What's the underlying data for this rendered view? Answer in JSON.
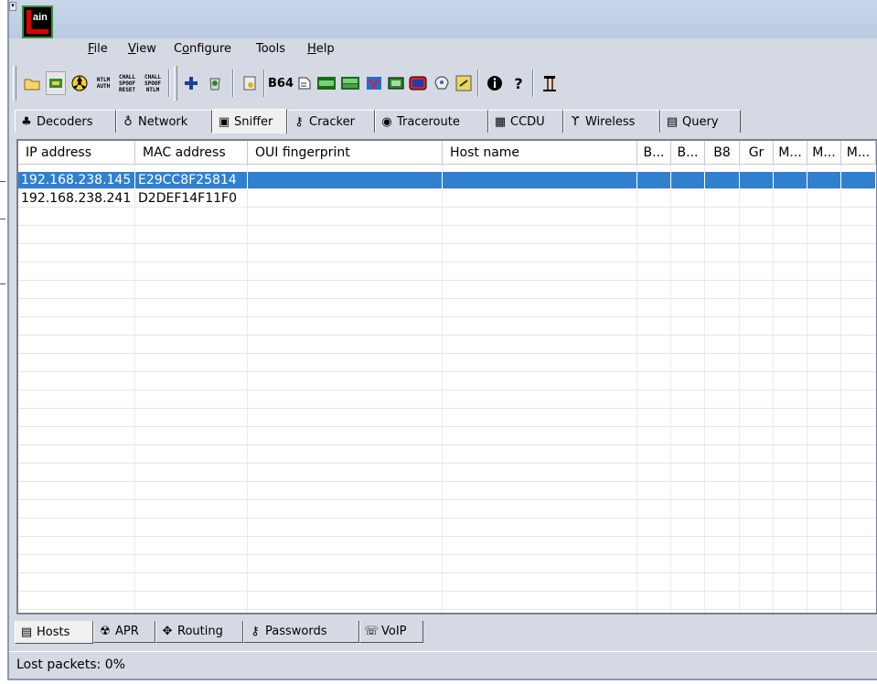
{
  "app": {
    "logo_text": "ain"
  },
  "menu": [
    {
      "label": "File",
      "ul": "F",
      "rest": "ile"
    },
    {
      "label": "View",
      "ul": "V",
      "rest": "iew"
    },
    {
      "label": "Configure",
      "ul": "o",
      "pre": "C",
      "rest": "nfigure"
    },
    {
      "label": "Tools",
      "ul": "",
      "rest": "Tools"
    },
    {
      "label": "Help",
      "ul": "H",
      "rest": "elp"
    }
  ],
  "toolbar": {
    "ntlm_auth": "NTLM\nAUTH",
    "chall_spoof_reset": "CHALL\nSPOOF\nRESET",
    "chall_spoof_ntlm": "CHALL\nSPOOF\nNTLM",
    "b64": "B64"
  },
  "top_tabs": [
    {
      "label": "Decoders",
      "icon": "decoders-icon"
    },
    {
      "label": "Network",
      "icon": "network-icon"
    },
    {
      "label": "Sniffer",
      "icon": "sniffer-icon"
    },
    {
      "label": "Cracker",
      "icon": "cracker-icon"
    },
    {
      "label": "Traceroute",
      "icon": "traceroute-icon"
    },
    {
      "label": "CCDU",
      "icon": "ccdu-icon"
    },
    {
      "label": "Wireless",
      "icon": "wireless-icon"
    },
    {
      "label": "Query",
      "icon": "query-icon"
    }
  ],
  "columns": [
    "IP address",
    "MAC address",
    "OUI fingerprint",
    "Host name",
    "B...",
    "B...",
    "B8",
    "Gr",
    "M...",
    "M...",
    "M..."
  ],
  "rows": [
    {
      "ip": "192.168.238.145",
      "mac": "E29CC8F25814"
    },
    {
      "ip": "192.168.238.241",
      "mac": "D2DEF14F11F0"
    }
  ],
  "bottom_tabs": [
    {
      "label": "Hosts",
      "icon": "hosts-icon"
    },
    {
      "label": "APR",
      "icon": "apr-icon"
    },
    {
      "label": "Routing",
      "icon": "routing-icon"
    },
    {
      "label": "Passwords",
      "icon": "passwords-icon"
    },
    {
      "label": "VoIP",
      "icon": "voip-icon"
    }
  ],
  "status": {
    "lost_packets": "Lost packets:  0%"
  },
  "colors": {
    "selection": "#3180d0",
    "window_bg": "#d4d9e3",
    "title_bg": "#c8d6e8"
  }
}
